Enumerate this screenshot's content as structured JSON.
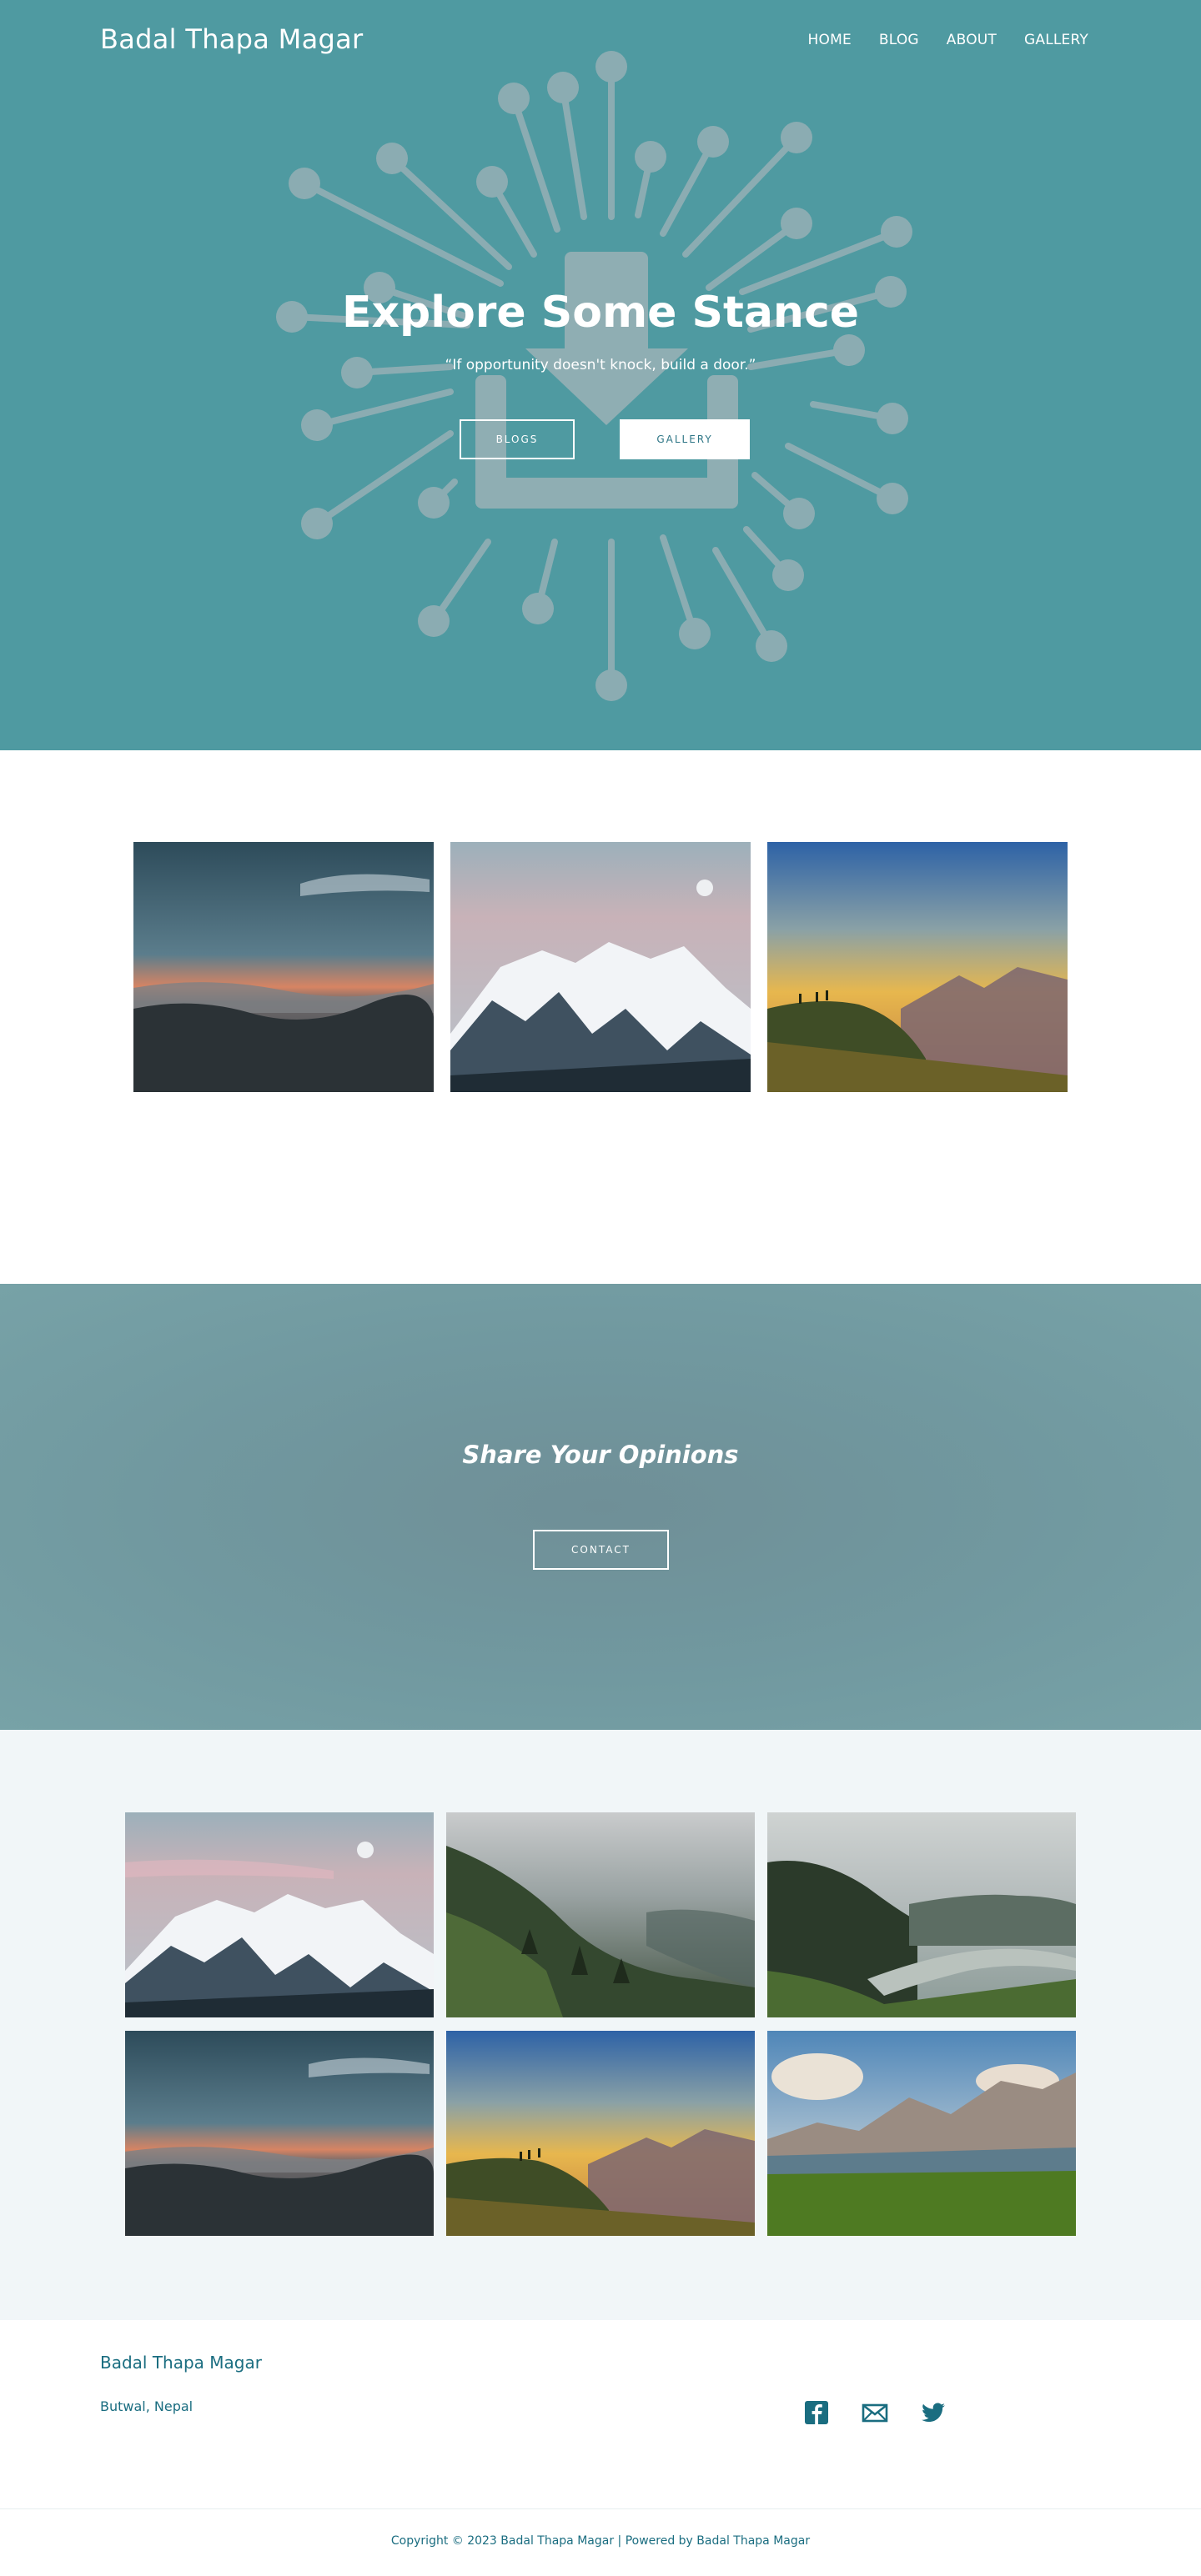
{
  "header": {
    "site_title": "Badal Thapa Magar",
    "nav": [
      "HOME",
      "BLOG",
      "ABOUT",
      "GALLERY"
    ]
  },
  "hero": {
    "title": "Explore Some Stance",
    "quote": "“If opportunity doesn't knock, build a door.”",
    "blogs_button": "BLOGS",
    "gallery_button": "GALLERY",
    "background_color": "#4f9aa1"
  },
  "featured_photos": [
    {
      "scene": "sunset-cloud-sea"
    },
    {
      "scene": "snowy-mountain-moon"
    },
    {
      "scene": "hikers-ridge-sunset"
    }
  ],
  "opinion": {
    "title": "Share Your Opinions",
    "contact_button": "CONTACT"
  },
  "gallery": {
    "photos": [
      {
        "scene": "snowy-mountain-moon"
      },
      {
        "scene": "misty-forest-valley"
      },
      {
        "scene": "river-valley-hills"
      },
      {
        "scene": "sunset-cloud-sea"
      },
      {
        "scene": "hikers-ridge-sunset"
      },
      {
        "scene": "lake-mountains"
      }
    ]
  },
  "footer": {
    "name": "Badal Thapa Magar",
    "location": "Butwal, Nepal",
    "social": [
      "facebook-icon",
      "mail-icon",
      "twitter-icon"
    ],
    "copyright": "Copyright © 2023 Badal Thapa Magar | Powered by Badal Thapa Magar"
  },
  "colors": {
    "brand_text": "#1a6d80",
    "opinion_band": "#7199a0",
    "gallery_bg": "#f1f6f8"
  }
}
